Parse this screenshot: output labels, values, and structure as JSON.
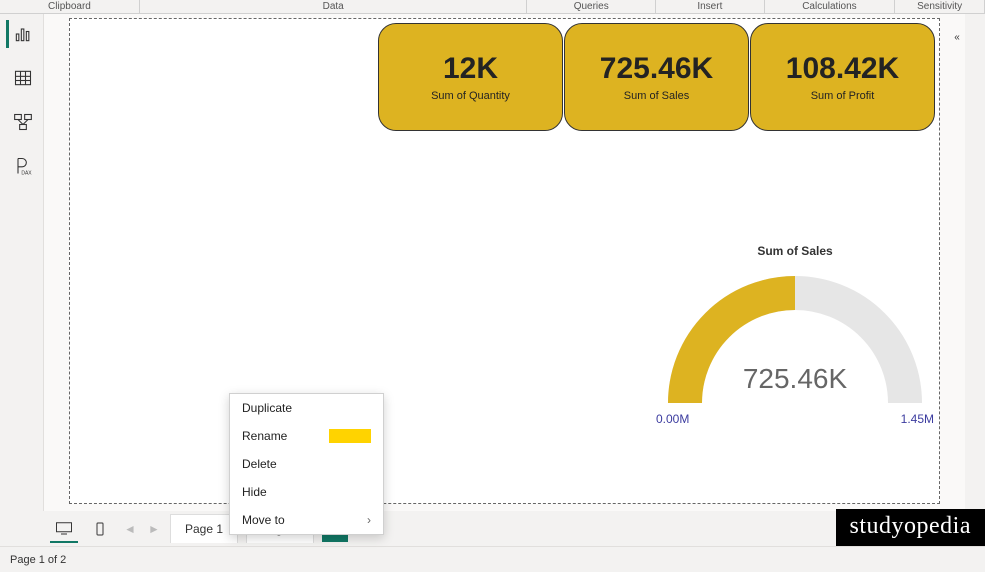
{
  "ribbon": [
    "Clipboard",
    "Data",
    "Queries",
    "Insert",
    "Calculations",
    "Sensitivity"
  ],
  "ribbon_widths": [
    148,
    410,
    136,
    115,
    138,
    95
  ],
  "cards": [
    {
      "value": "12K",
      "label": "Sum of Quantity"
    },
    {
      "value": "725.46K",
      "label": "Sum of Sales"
    },
    {
      "value": "108.42K",
      "label": "Sum of Profit"
    }
  ],
  "gauge": {
    "title": "Sum of Sales",
    "center": "725.46K",
    "min": "0.00M",
    "max": "1.45M"
  },
  "context": {
    "duplicate": "Duplicate",
    "rename": "Rename",
    "delete_": "Delete",
    "hide": "Hide",
    "moveto": "Move to"
  },
  "pages": {
    "p1": "Page 1",
    "p2": "Page 2",
    "add": "+"
  },
  "status": "Page 1 of 2",
  "watermark": "studyopedia",
  "chart_data": {
    "type": "bar",
    "cards": [
      {
        "metric": "Sum of Quantity",
        "value": 12000,
        "display": "12K"
      },
      {
        "metric": "Sum of Sales",
        "value": 725460,
        "display": "725.46K"
      },
      {
        "metric": "Sum of Profit",
        "value": 108420,
        "display": "108.42K"
      }
    ],
    "gauge": {
      "metric": "Sum of Sales",
      "value": 725460,
      "min": 0,
      "max": 1450000,
      "min_label": "0.00M",
      "max_label": "1.45M"
    }
  }
}
